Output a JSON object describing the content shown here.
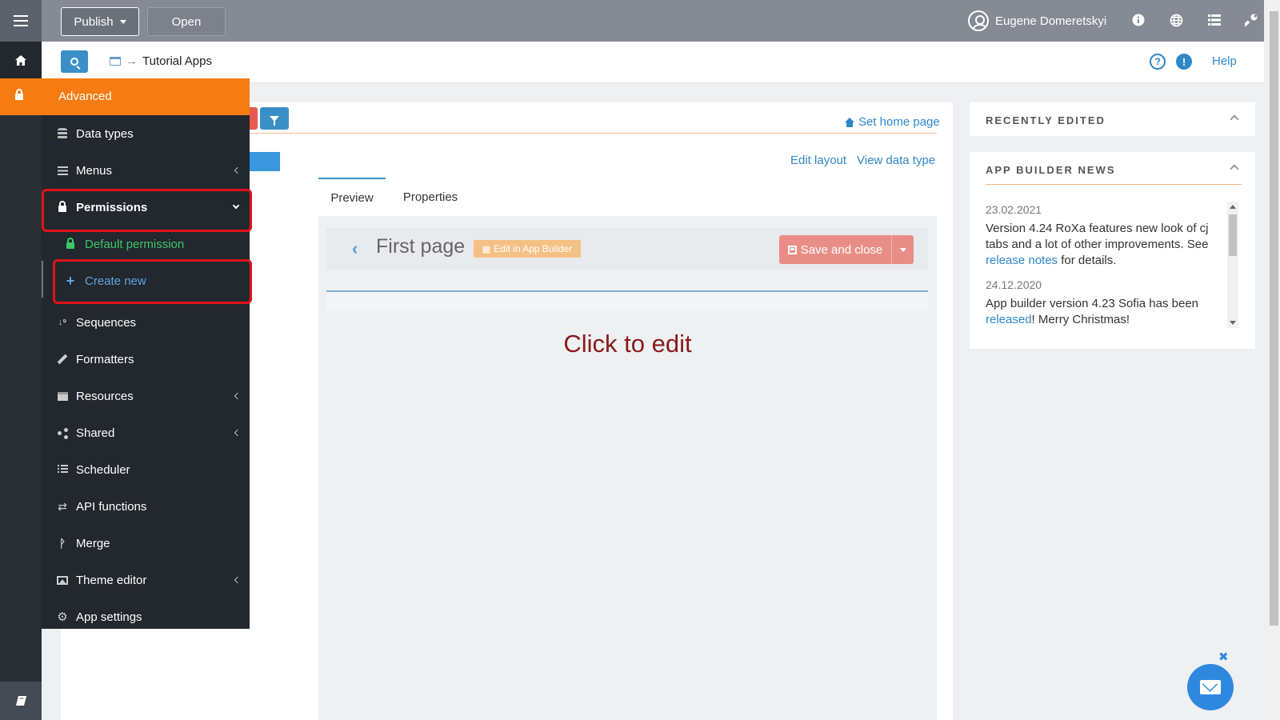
{
  "topbar": {
    "publish_label": "Publish",
    "open_label": "Open",
    "user_name": "Eugene Domeretskyi"
  },
  "subbar": {
    "breadcrumb_arrow": "→",
    "breadcrumb_label": "Tutorial Apps",
    "help_label": "Help"
  },
  "content": {
    "set_home_label": "Set home page",
    "edit_layout_label": "Edit layout",
    "view_data_type_label": "View data type",
    "tabs": [
      {
        "label": "Preview"
      },
      {
        "label": "Properties"
      }
    ],
    "page_title": "First page",
    "edit_in_builder_label": "Edit in App Builder",
    "save_close_label": "Save and close",
    "click_to_edit": "Click to edit"
  },
  "menu": {
    "header_label": "Advanced",
    "items": [
      {
        "label": "Data types"
      },
      {
        "label": "Menus"
      },
      {
        "label": "Permissions"
      },
      {
        "label": "Default permission"
      },
      {
        "label": "Create new"
      },
      {
        "label": "Sequences"
      },
      {
        "label": "Formatters"
      },
      {
        "label": "Resources"
      },
      {
        "label": "Shared"
      },
      {
        "label": "Scheduler"
      },
      {
        "label": "API functions"
      },
      {
        "label": "Merge"
      },
      {
        "label": "Theme editor"
      },
      {
        "label": "App settings"
      }
    ]
  },
  "recently_edited": {
    "title": "RECENTLY EDITED"
  },
  "news": {
    "title": "APP BUILDER NEWS",
    "items": [
      {
        "date": "23.02.2021",
        "text_before": "Version 4.24 RoXa features new look of cj tabs and a lot of other improvements. See ",
        "link": "release notes",
        "text_after": " for details."
      },
      {
        "date": "24.12.2020",
        "text_before": "App builder version 4.23 Sofia has been ",
        "link": "released",
        "text_after": "! Merry Christmas!"
      }
    ]
  },
  "colors": {
    "accent_orange": "#f57c12",
    "accent_blue": "#2f88c9",
    "highlight_red": "#e0131a",
    "menu_bg": "#23272e"
  }
}
